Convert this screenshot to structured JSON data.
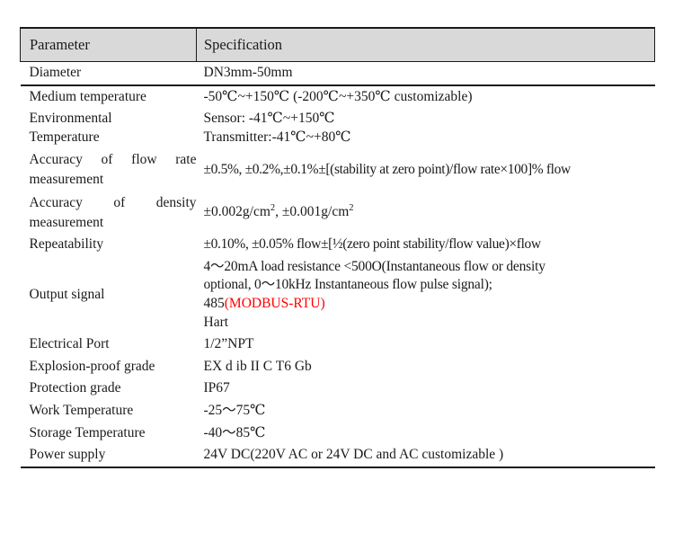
{
  "table": {
    "headers": {
      "parameter": "Parameter",
      "specification": "Specification"
    },
    "rows": [
      {
        "parameter": "Diameter",
        "specification": "DN3mm-50mm"
      },
      {
        "parameter": "Medium temperature",
        "specification": "-50℃~+150℃ (-200℃~+350℃ customizable)"
      },
      {
        "parameter_line1": "Environmental",
        "parameter_line2": "Temperature",
        "specification_line1": "Sensor: -41℃~+150℃",
        "specification_line2": "Transmitter:-41℃~+80℃"
      },
      {
        "parameter_line1": "Accuracy of flow rate",
        "parameter_line2": "measurement",
        "specification": "±0.5%, ±0.2%,±0.1%±[(stability at zero point)/flow rate×100]% flow"
      },
      {
        "parameter_line1": "Accuracy of density",
        "parameter_line2": "measurement",
        "specification_prefix": "±0.002g/cm",
        "specification_sup1": "2",
        "specification_middle": ", ±0.001g/cm",
        "specification_sup2": "2"
      },
      {
        "parameter": "Repeatability",
        "specification": "±0.10%, ±0.05% flow±[½(zero point stability/flow value)×flow"
      },
      {
        "parameter": "Output signal",
        "specification_line1": "4～20mA load resistance <500O(Instantaneous flow or density",
        "specification_line2": "optional, 0～10kHz Instantaneous flow pulse signal);",
        "specification_line3_black": "485",
        "specification_line3_red": "(MODBUS-RTU)",
        "specification_line4": "Hart"
      },
      {
        "parameter": "Electrical Port",
        "specification": "1/2”NPT"
      },
      {
        "parameter": "Explosion-proof grade",
        "specification": "EX d ib II C T6 Gb"
      },
      {
        "parameter": "Protection grade",
        "specification": "IP67"
      },
      {
        "parameter": "Work Temperature",
        "specification": "-25～75℃"
      },
      {
        "parameter": "Storage Temperature",
        "specification": "-40～85℃"
      },
      {
        "parameter": "Power supply",
        "specification": "24V DC(220V AC or 24V DC and AC customizable )"
      }
    ]
  },
  "colors": {
    "header_background": "#d9d9d9",
    "border": "#1a1a1a",
    "text": "#1a1a1a",
    "accent_red": "#ff0000"
  }
}
